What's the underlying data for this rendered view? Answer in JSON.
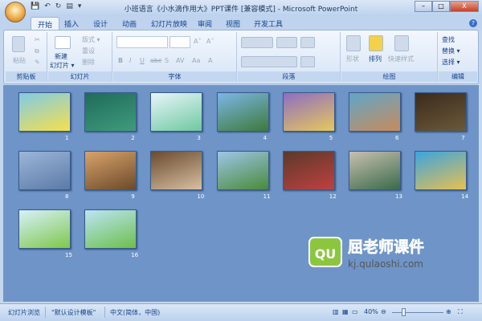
{
  "window": {
    "title": "小班语言《小水滴作用大》PPT课件 [兼容模式] - Microsoft PowerPoint",
    "min": "–",
    "max": "□",
    "close": "X"
  },
  "tabs": [
    "开始",
    "插入",
    "设计",
    "动画",
    "幻灯片放映",
    "审阅",
    "视图",
    "开发工具"
  ],
  "ribbon": {
    "clipboard": {
      "label": "剪贴板",
      "paste": "粘贴"
    },
    "slides": {
      "label": "幻灯片",
      "new_slide_1": "新建",
      "new_slide_2": "幻灯片 ▾",
      "layout": "版式 ▾",
      "reset": "重设",
      "delete": "删除"
    },
    "font": {
      "label": "字体",
      "bold": "B",
      "italic": "I",
      "underline": "U",
      "strike": "abc",
      "shadow": "S",
      "spacing": "AV",
      "case": "Aa",
      "color": "A",
      "grow": "A˄",
      "shrink": "A˅"
    },
    "paragraph": {
      "label": "段落"
    },
    "drawing": {
      "label": "绘图",
      "shapes": "形状",
      "arrange": "排列",
      "quick_styles": "快速样式"
    },
    "editing": {
      "label": "编辑",
      "find": "查找",
      "replace": "替换 ▾",
      "select": "选择 ▾"
    }
  },
  "slides": [
    {
      "n": "1",
      "c1": "#7fcbe8",
      "c2": "#f6e04a"
    },
    {
      "n": "2",
      "c1": "#1f6b5a",
      "c2": "#3f9b7c"
    },
    {
      "n": "3",
      "c1": "#e8f6fb",
      "c2": "#6ec8a0"
    },
    {
      "n": "4",
      "c1": "#7cb6e6",
      "c2": "#3e7a3a"
    },
    {
      "n": "5",
      "c1": "#8e6cc4",
      "c2": "#e7c85a"
    },
    {
      "n": "6",
      "c1": "#5fa6c9",
      "c2": "#c98b5a"
    },
    {
      "n": "7",
      "c1": "#3b2a1c",
      "c2": "#6a5a3a"
    },
    {
      "n": "8",
      "c1": "#9cb6d8",
      "c2": "#5b7aa8"
    },
    {
      "n": "9",
      "c1": "#d9a36a",
      "c2": "#6b4a2a"
    },
    {
      "n": "10",
      "c1": "#6a4a30",
      "c2": "#d8c0a0"
    },
    {
      "n": "11",
      "c1": "#9ec6e8",
      "c2": "#4a8a3a"
    },
    {
      "n": "12",
      "c1": "#5a3a2a",
      "c2": "#c04040"
    },
    {
      "n": "13",
      "c1": "#c8c0b0",
      "c2": "#3a6a4a"
    },
    {
      "n": "14",
      "c1": "#3ba4e0",
      "c2": "#e8c050"
    },
    {
      "n": "15",
      "c1": "#d8f0fb",
      "c2": "#7ec84a"
    },
    {
      "n": "16",
      "c1": "#bde4f6",
      "c2": "#6cc04a"
    }
  ],
  "watermark": {
    "logo": "QU",
    "name": "屈老师课件",
    "url": "kj.qulaoshi.com"
  },
  "status": {
    "view": "幻灯片浏览",
    "theme": "\"默认设计模板\"",
    "lang": "中文(简体，中国)",
    "zoom": "40%",
    "zoom_value": 40
  }
}
